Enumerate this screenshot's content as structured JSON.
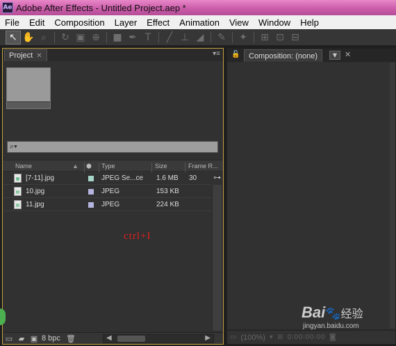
{
  "window": {
    "title": "Adobe After Effects - Untitled Project.aep *",
    "icon_label": "Ae"
  },
  "menu": [
    "File",
    "Edit",
    "Composition",
    "Layer",
    "Effect",
    "Animation",
    "View",
    "Window",
    "Help"
  ],
  "toolbar": {
    "tools": [
      {
        "icon": "selection-tool-icon",
        "glyph": "↖",
        "active": true
      },
      {
        "icon": "hand-tool-icon",
        "glyph": "✋"
      },
      {
        "icon": "zoom-tool-icon",
        "glyph": "🔍"
      },
      {
        "icon": "rotate-tool-icon",
        "glyph": "↻"
      },
      {
        "icon": "camera-tool-icon",
        "glyph": "▣"
      },
      {
        "icon": "pan-behind-tool-icon",
        "glyph": "⊕"
      },
      {
        "icon": "rectangle-tool-icon",
        "glyph": "■"
      },
      {
        "icon": "pen-tool-icon",
        "glyph": "✒"
      },
      {
        "icon": "type-tool-icon",
        "glyph": "T"
      },
      {
        "icon": "brush-tool-icon",
        "glyph": "╱"
      },
      {
        "icon": "clone-stamp-tool-icon",
        "glyph": "⊥"
      },
      {
        "icon": "eraser-tool-icon",
        "glyph": "◢"
      },
      {
        "icon": "roto-brush-tool-icon",
        "glyph": "✎"
      },
      {
        "icon": "puppet-pin-tool-icon",
        "glyph": "✦"
      },
      {
        "icon": "axis-mode-icon",
        "glyph": "⊞"
      },
      {
        "icon": "world-axis-icon",
        "glyph": "⊡"
      },
      {
        "icon": "view-axis-icon",
        "glyph": "⊟"
      }
    ]
  },
  "project_panel": {
    "tab_label": "Project",
    "columns": {
      "name": "Name",
      "type": "Type",
      "size": "Size",
      "frame_rate": "Frame R..."
    },
    "items": [
      {
        "name": "[7-11].jpg",
        "label_color": "#a6d6c8",
        "type": "JPEG Se...ce",
        "size": "1.6 MB",
        "frame_rate": "30"
      },
      {
        "name": "10.jpg",
        "label_color": "#b4b4de",
        "type": "JPEG",
        "size": "153 KB",
        "frame_rate": ""
      },
      {
        "name": "11.jpg",
        "label_color": "#b4b4de",
        "type": "JPEG",
        "size": "224 KB",
        "frame_rate": ""
      }
    ],
    "annotation": "ctrl+I",
    "bit_depth": "8 bpc"
  },
  "composition_panel": {
    "tab_label": "Composition: (none)",
    "zoom": "(100%)",
    "timecode": "0:00:00:00"
  },
  "watermark": {
    "logo_text": "Bai",
    "logo_text_end": "经验",
    "url": "jingyan.baidu.com"
  }
}
